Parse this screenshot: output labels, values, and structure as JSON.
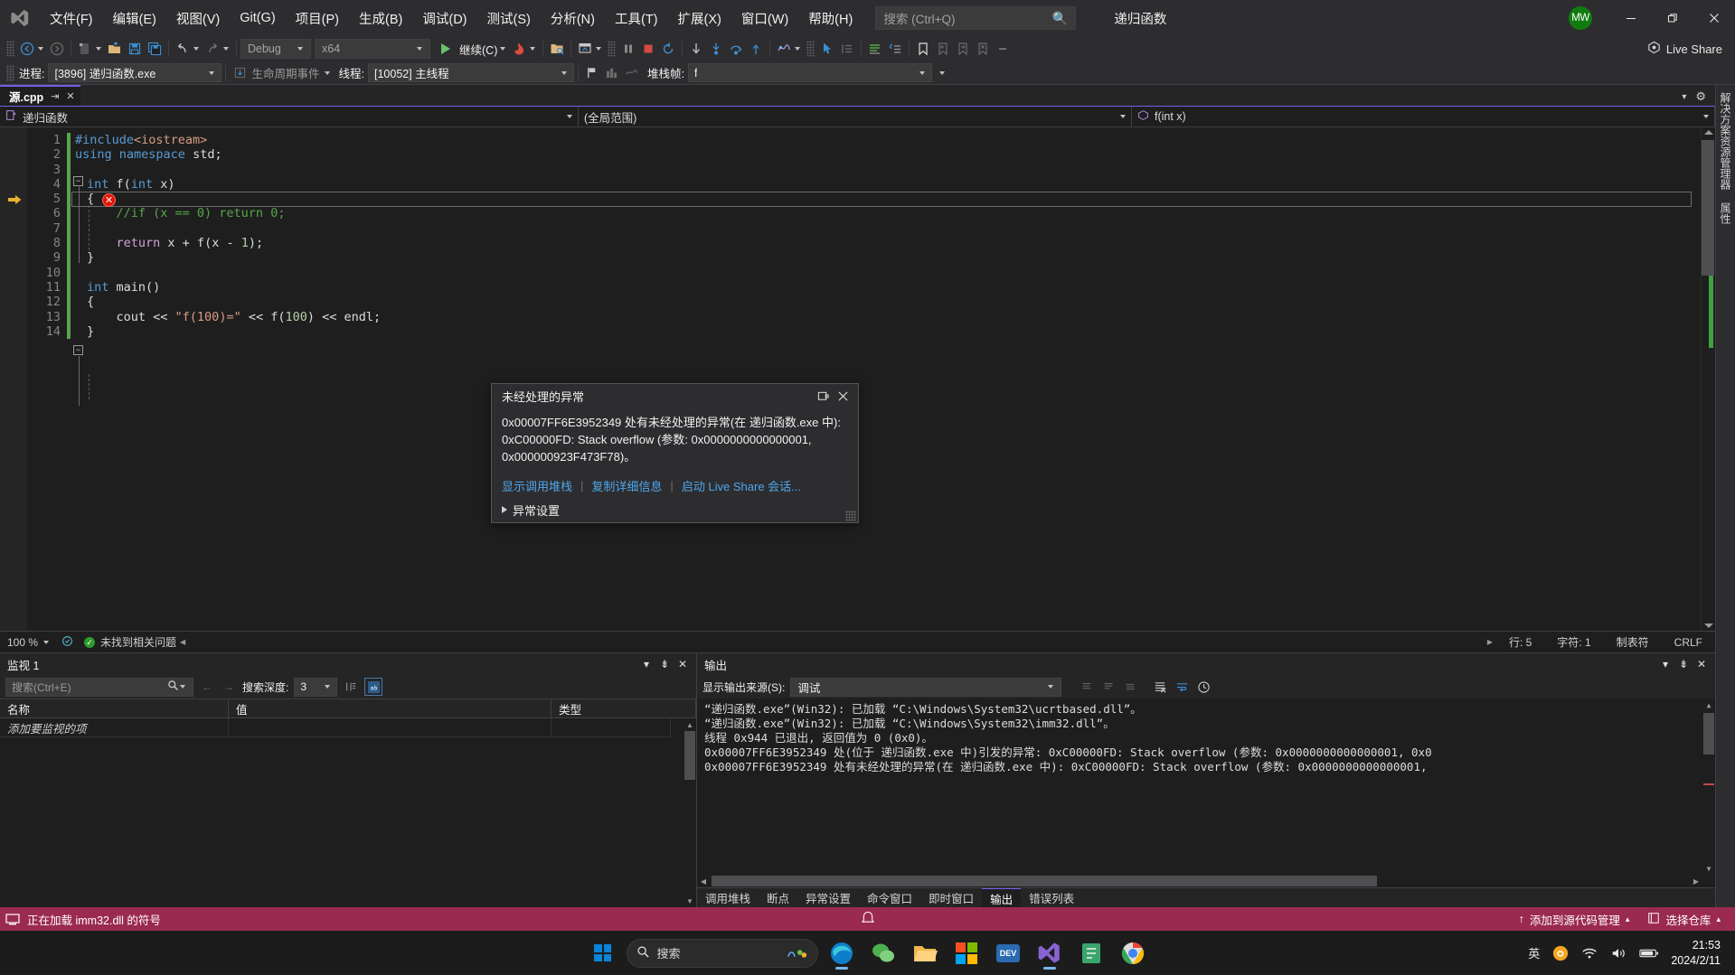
{
  "titlebar": {
    "logo_icon": "visual-studio-logo",
    "menus": [
      {
        "label": "文件(F)"
      },
      {
        "label": "编辑(E)"
      },
      {
        "label": "视图(V)"
      },
      {
        "label": "Git(G)"
      },
      {
        "label": "项目(P)"
      },
      {
        "label": "生成(B)"
      },
      {
        "label": "调试(D)"
      },
      {
        "label": "测试(S)"
      },
      {
        "label": "分析(N)"
      },
      {
        "label": "工具(T)"
      },
      {
        "label": "扩展(X)"
      },
      {
        "label": "窗口(W)"
      },
      {
        "label": "帮助(H)"
      }
    ],
    "search_placeholder": "搜索 (Ctrl+Q)",
    "search_value": "",
    "solution_name": "递归函数",
    "avatar_initials": "MW",
    "minimize": "—",
    "restore": "❐",
    "close": "✕"
  },
  "toolbar": {
    "nav_back_icon": "navigate-back-icon",
    "nav_forward_icon": "navigate-forward-icon",
    "new_item_icon": "new-item-icon",
    "open_file_icon": "open-file-icon",
    "save_icon": "save-icon",
    "save_all_icon": "save-all-icon",
    "undo_icon": "undo-icon",
    "redo_icon": "redo-icon",
    "config_value": "Debug",
    "platform_value": "x64",
    "run_label": "继续(C)",
    "hot_reload_icon": "hot-reload-icon",
    "attach_icon": "attach-process-icon",
    "breakall_icon": "break-all-icon",
    "pause_icon": "pause-icon",
    "stop_icon": "stop-debug-icon",
    "restart_icon": "restart-debug-icon",
    "showstatement_icon": "show-next-statement-icon",
    "stepinto_icon": "step-into-icon",
    "stepover_icon": "step-over-icon",
    "stepout_icon": "step-out-icon",
    "threads_icon": "threads-icon",
    "pointer_icon": "select-pointer-icon",
    "indent_icon": "indent-icon",
    "comment_icon": "comment-icon",
    "uncomment_icon": "uncomment-icon",
    "bookmark_icon": "bookmark-icon",
    "prev_bookmark_icon": "previous-bookmark-icon",
    "next_bookmark_icon": "next-bookmark-icon",
    "clear_bookmark_icon": "clear-bookmark-icon",
    "live_share_label": "Live Share",
    "live_share_icon": "live-share-icon"
  },
  "debugbar": {
    "process_label": "进程:",
    "process_value": "[3896] 递归函数.exe",
    "lifecycle_label": "生命周期事件",
    "lifecycle_icon": "lifecycle-events-icon",
    "thread_label": "线程:",
    "thread_value": "[10052] 主线程",
    "stackframe_label": "堆栈帧:",
    "stackframe_value": "f",
    "flag_icon": "flag-icon",
    "modules_icon": "modules-icon"
  },
  "editor": {
    "tab_name": "源.cpp",
    "tab_pin_icon": "pin-icon",
    "tab_close_icon": "close-icon",
    "navbar": {
      "project": "递归函数",
      "scope": "(全局范围)",
      "member": "f(int x)",
      "project_icon": "project-icon",
      "member_icon": "method-icon"
    },
    "lines": [
      {
        "n": 1,
        "tokens": [
          {
            "t": "#include",
            "c": "kw"
          },
          {
            "t": "<iostream>",
            "c": "hdr"
          }
        ],
        "indent": 0
      },
      {
        "n": 2,
        "tokens": [
          {
            "t": "using",
            "c": "kw"
          },
          {
            "t": " ",
            "c": ""
          },
          {
            "t": "namespace",
            "c": "kw"
          },
          {
            "t": " std;",
            "c": ""
          }
        ],
        "indent": 0
      },
      {
        "n": 3,
        "tokens": [],
        "indent": 0
      },
      {
        "n": 4,
        "tokens": [
          {
            "t": "int",
            "c": "kw"
          },
          {
            "t": " f(",
            "c": ""
          },
          {
            "t": "int",
            "c": "kw"
          },
          {
            "t": " x)",
            "c": ""
          }
        ],
        "indent": 0,
        "fold": true
      },
      {
        "n": 5,
        "tokens": [
          {
            "t": "{",
            "c": ""
          }
        ],
        "indent": 1,
        "current": true,
        "breakpoint_error": true
      },
      {
        "n": 6,
        "tokens": [
          {
            "t": "    //if (x == 0) return 0;",
            "c": "cmt"
          }
        ],
        "indent": 1
      },
      {
        "n": 7,
        "tokens": [],
        "indent": 1
      },
      {
        "n": 8,
        "tokens": [
          {
            "t": "    ",
            "c": ""
          },
          {
            "t": "return",
            "c": "kw2"
          },
          {
            "t": " x + f(x - ",
            "c": ""
          },
          {
            "t": "1",
            "c": "num"
          },
          {
            "t": ");",
            "c": ""
          }
        ],
        "indent": 1
      },
      {
        "n": 9,
        "tokens": [
          {
            "t": "}",
            "c": ""
          }
        ],
        "indent": 1
      },
      {
        "n": 10,
        "tokens": [],
        "indent": 0
      },
      {
        "n": 11,
        "tokens": [
          {
            "t": "int",
            "c": "kw"
          },
          {
            "t": " main()",
            "c": ""
          }
        ],
        "indent": 0,
        "fold": true
      },
      {
        "n": 12,
        "tokens": [
          {
            "t": "{",
            "c": ""
          }
        ],
        "indent": 1
      },
      {
        "n": 13,
        "tokens": [
          {
            "t": "    cout << ",
            "c": ""
          },
          {
            "t": "\"f(100)=\"",
            "c": "str"
          },
          {
            "t": " << f(",
            "c": ""
          },
          {
            "t": "100",
            "c": "num"
          },
          {
            "t": ") << endl;",
            "c": ""
          }
        ],
        "indent": 1
      },
      {
        "n": 14,
        "tokens": [
          {
            "t": "}",
            "c": ""
          }
        ],
        "indent": 1
      }
    ],
    "status": {
      "zoom": "100 %",
      "issues_text": "未找到相关问题",
      "issues_icon": "checkmark-icon",
      "row_label": "行: 5",
      "col_label": "字符: 1",
      "tabs_label": "制表符",
      "eol_label": "CRLF"
    }
  },
  "exception_dialog": {
    "title": "未经处理的异常",
    "undock_icon": "undock-icon",
    "close_icon": "close-icon",
    "message_lines": [
      "0x00007FF6E3952349 处有未经处理的异常(在 递归函数.exe 中):",
      "0xC00000FD: Stack overflow (参数: 0x0000000000000001,",
      "0x000000923F473F78)。"
    ],
    "links": [
      {
        "label": "显示调用堆栈"
      },
      {
        "label": "复制详细信息"
      },
      {
        "label": "启动 Live Share 会话..."
      }
    ],
    "settings_label": "异常设置",
    "expander_icon": "expander-collapsed-icon"
  },
  "watch_panel": {
    "title": "监视 1",
    "dropdown_icon": "chevron-down-icon",
    "pin_icon": "pin-icon",
    "close_icon": "close-icon",
    "search_placeholder": "搜索(Ctrl+E)",
    "search_value": "",
    "search_icon": "search-icon",
    "search_dropdown_icon": "chevron-down-icon",
    "prev_icon": "previous-icon",
    "next_icon": "next-icon",
    "depth_label": "搜索深度:",
    "depth_value": "3",
    "columns_icon": "columns-icon",
    "hex_icon": "hexadecimal-display-icon",
    "columns": [
      {
        "label": "名称"
      },
      {
        "label": "值"
      },
      {
        "label": "类型"
      }
    ],
    "rows": [
      {
        "name": "添加要监视的项",
        "value": "",
        "type": ""
      }
    ]
  },
  "output_panel": {
    "title": "输出",
    "dropdown_icon": "chevron-down-icon",
    "pin_icon": "pin-icon",
    "close_icon": "close-icon",
    "source_label": "显示输出来源(S):",
    "source_value": "调试",
    "clear_icon": "clear-output-icon",
    "toggle_wordwrap_icon": "word-wrap-icon",
    "history_icon": "history-icon",
    "lines": [
      "“递归函数.exe”(Win32): 已加载 “C:\\Windows\\System32\\ucrtbased.dll”。",
      "“递归函数.exe”(Win32): 已加载 “C:\\Windows\\System32\\imm32.dll”。",
      "线程 0x944 已退出, 返回值为 0 (0x0)。",
      "0x00007FF6E3952349 处(位于 递归函数.exe 中)引发的异常: 0xC00000FD: Stack overflow (参数: 0x0000000000000001, 0x0",
      "0x00007FF6E3952349 处有未经处理的异常(在 递归函数.exe 中): 0xC00000FD: Stack overflow (参数: 0x0000000000000001,"
    ],
    "tabs": [
      {
        "label": "调用堆栈",
        "active": false
      },
      {
        "label": "断点",
        "active": false
      },
      {
        "label": "异常设置",
        "active": false
      },
      {
        "label": "命令窗口",
        "active": false
      },
      {
        "label": "即时窗口",
        "active": false
      },
      {
        "label": "输出",
        "active": true
      },
      {
        "label": "错误列表",
        "active": false
      }
    ]
  },
  "right_rail": {
    "tabs": [
      {
        "label": "解决方案资源管理器"
      },
      {
        "label": "属性"
      }
    ]
  },
  "statusbar": {
    "status_text": "正在加载 imm32.dll 的符号",
    "status_icon": "debug-symbols-icon",
    "notify_icon": "notifications-icon",
    "source_control_label": "添加到源代码管理",
    "source_control_icon": "source-control-icon",
    "repo_label": "选择仓库",
    "repo_icon": "repository-icon",
    "up_arrow_icon": "up-arrow-icon",
    "accent_color": "#9b2a50"
  },
  "taskbar": {
    "start_icon": "windows-start-icon",
    "search_placeholder": "搜索",
    "search_icon": "search-icon",
    "widgets_icon": "widgets-icon",
    "apps": [
      {
        "name": "edge-icon",
        "running": true
      },
      {
        "name": "wechat-icon",
        "running": false
      },
      {
        "name": "file-explorer-icon",
        "running": false
      },
      {
        "name": "microsoft-store-icon",
        "running": false
      },
      {
        "name": "devcpp-icon",
        "running": false
      },
      {
        "name": "visual-studio-icon",
        "running": true
      },
      {
        "name": "notes-icon",
        "running": false
      },
      {
        "name": "chrome-icon",
        "running": false
      }
    ],
    "tray": {
      "ime_label": "英",
      "sogou_icon": "sogou-input-icon",
      "wifi_icon": "wifi-icon",
      "volume_icon": "volume-icon",
      "battery_icon": "battery-icon",
      "time": "21:53",
      "date": "2024/2/11"
    }
  }
}
